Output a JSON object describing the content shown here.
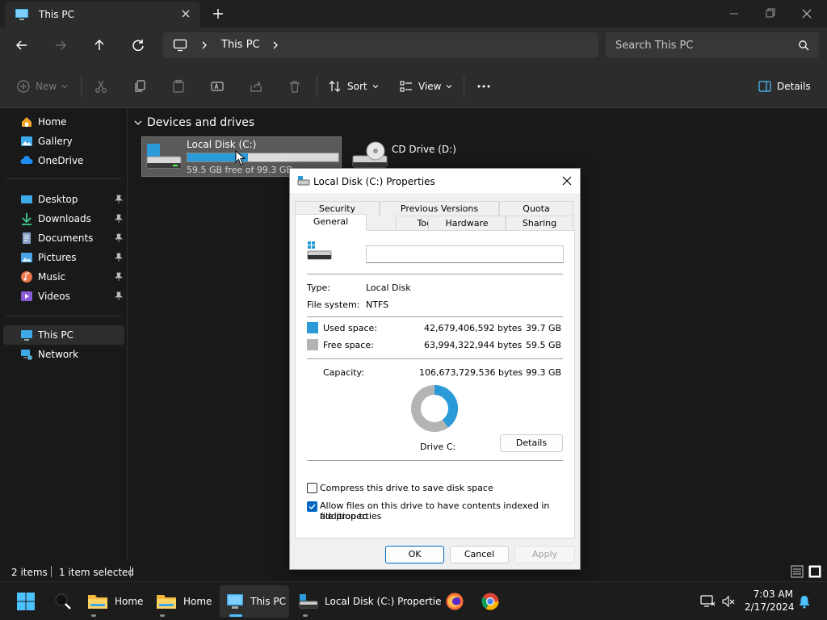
{
  "window": {
    "tab_title": "This PC"
  },
  "address": {
    "location": "This PC",
    "search_placeholder": "Search This PC"
  },
  "commandbar": {
    "new_label": "New",
    "sort_label": "Sort",
    "view_label": "View",
    "details_label": "Details"
  },
  "sidebar": {
    "items": [
      {
        "label": "Home",
        "icon": "home-icon"
      },
      {
        "label": "Gallery",
        "icon": "gallery-icon"
      },
      {
        "label": "OneDrive",
        "icon": "cloud-icon"
      },
      {
        "label": "Desktop",
        "icon": "desktop-icon",
        "pinned": true
      },
      {
        "label": "Downloads",
        "icon": "download-icon",
        "pinned": true
      },
      {
        "label": "Documents",
        "icon": "documents-icon",
        "pinned": true
      },
      {
        "label": "Pictures",
        "icon": "pictures-icon",
        "pinned": true
      },
      {
        "label": "Music",
        "icon": "music-icon",
        "pinned": true
      },
      {
        "label": "Videos",
        "icon": "videos-icon",
        "pinned": true
      },
      {
        "label": "This PC",
        "icon": "pc-icon",
        "selected": true
      },
      {
        "label": "Network",
        "icon": "network-icon"
      }
    ]
  },
  "main": {
    "section_title": "Devices and drives",
    "drives": [
      {
        "name": "Local Disk (C:)",
        "free_text": "59.5 GB free of 99.3 GB",
        "used_fraction": 0.4
      },
      {
        "name": "CD Drive (D:)"
      }
    ]
  },
  "status": {
    "item_count": "2 items",
    "selection": "1 item selected"
  },
  "taskbar": {
    "items": [
      {
        "label": "Home"
      },
      {
        "label": "Home"
      },
      {
        "label": "This PC"
      },
      {
        "label": "Local Disk (C:) Propertie"
      }
    ],
    "time": "7:03 AM",
    "date": "2/17/2024"
  },
  "dialog": {
    "title": "Local Disk (C:) Properties",
    "tabs_row1": [
      "Security",
      "Previous Versions",
      "Quota"
    ],
    "tabs_row2": [
      "General",
      "Tools",
      "Hardware",
      "Sharing"
    ],
    "drive_label_value": "",
    "type_label": "Type:",
    "type_value": "Local Disk",
    "fs_label": "File system:",
    "fs_value": "NTFS",
    "used_label": "Used space:",
    "used_bytes": "42,679,406,592 bytes",
    "used_gb": "39.7 GB",
    "free_label": "Free space:",
    "free_bytes": "63,994,322,944 bytes",
    "free_gb": "59.5 GB",
    "capacity_label": "Capacity:",
    "capacity_bytes": "106,673,729,536 bytes",
    "capacity_gb": "99.3 GB",
    "used_fraction": 0.4,
    "drive_caption": "Drive C:",
    "details_button": "Details",
    "compress_label": "Compress this drive to save disk space",
    "compress_checked": false,
    "index_label_line1": "Allow files on this drive to have contents indexed in addition to",
    "index_label_line2": "file properties",
    "index_checked": true,
    "ok_button": "OK",
    "cancel_button": "Cancel",
    "apply_button": "Apply"
  },
  "colors": {
    "accent": "#2a9ad8",
    "used_color": "#2a9ad8",
    "free_color": "#b4b4b4",
    "check_blue": "#0067c0"
  }
}
